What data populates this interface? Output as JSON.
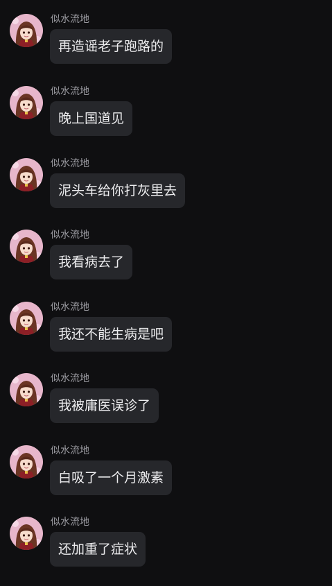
{
  "colors": {
    "background": "#0f0f11",
    "bubble": "#26272b",
    "sender_text": "#9a9aa0",
    "message_text": "#ececee"
  },
  "messages": [
    {
      "sender": "似水流地",
      "text": "再造谣老子跑路的"
    },
    {
      "sender": "似水流地",
      "text": "晚上国道见"
    },
    {
      "sender": "似水流地",
      "text": "泥头车给你打灰里去"
    },
    {
      "sender": "似水流地",
      "text": "我看病去了"
    },
    {
      "sender": "似水流地",
      "text": "我还不能生病是吧"
    },
    {
      "sender": "似水流地",
      "text": "我被庸医误诊了"
    },
    {
      "sender": "似水流地",
      "text": "白吸了一个月激素"
    },
    {
      "sender": "似水流地",
      "text": "还加重了症状"
    }
  ]
}
